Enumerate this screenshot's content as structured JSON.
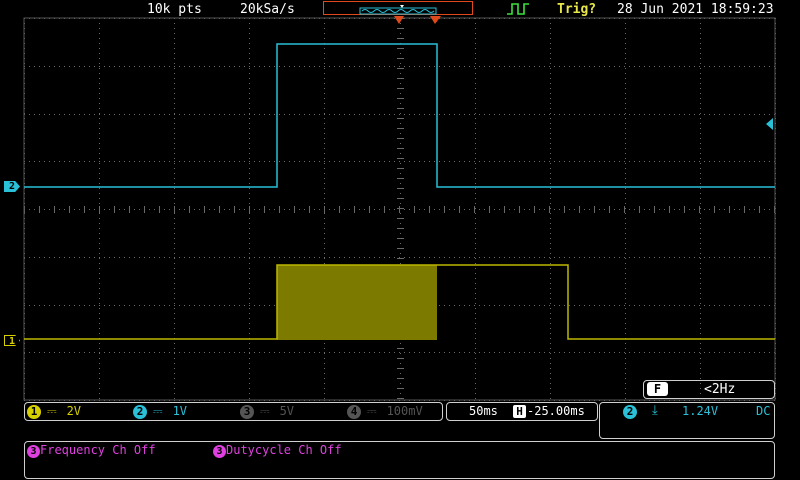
{
  "top_bar": {
    "record_length": "10k pts",
    "sample_rate": "20kSa/s",
    "trigger_status": "Trig?",
    "datetime": "28 Jun 2021 18:59:23"
  },
  "channels": [
    {
      "num": "1",
      "coupling_icon": "dc-coupling-icon",
      "scale": "2V",
      "color": "#d6d000",
      "enabled": true
    },
    {
      "num": "2",
      "coupling_icon": "dc-coupling-icon",
      "scale": "1V",
      "color": "#29c0d8",
      "enabled": true
    },
    {
      "num": "3",
      "coupling_icon": "dc-coupling-icon",
      "scale": "5V",
      "color": "#555555",
      "enabled": false
    },
    {
      "num": "4",
      "coupling_icon": "dc-coupling-icon",
      "scale": "100mV",
      "color": "#555555",
      "enabled": false
    }
  ],
  "markers": {
    "ch1": "1",
    "ch2": "2"
  },
  "timebase": {
    "scale": "50ms",
    "h_label": "H",
    "position": "-25.00ms"
  },
  "filter": {
    "label": "F",
    "value": "<2Hz"
  },
  "trigger": {
    "source": "2",
    "slope_icon": "falling-edge-icon",
    "level": "1.24V",
    "coupling": "DC"
  },
  "measurements": [
    {
      "num": "3",
      "text": "Frequency Ch Off"
    },
    {
      "num": "3",
      "text": "Dutycycle Ch Off"
    }
  ],
  "colors": {
    "ch1": "#d6d000",
    "ch2": "#29c0d8",
    "math": "#e040e0",
    "trigger_box": "#e04a1a"
  }
}
